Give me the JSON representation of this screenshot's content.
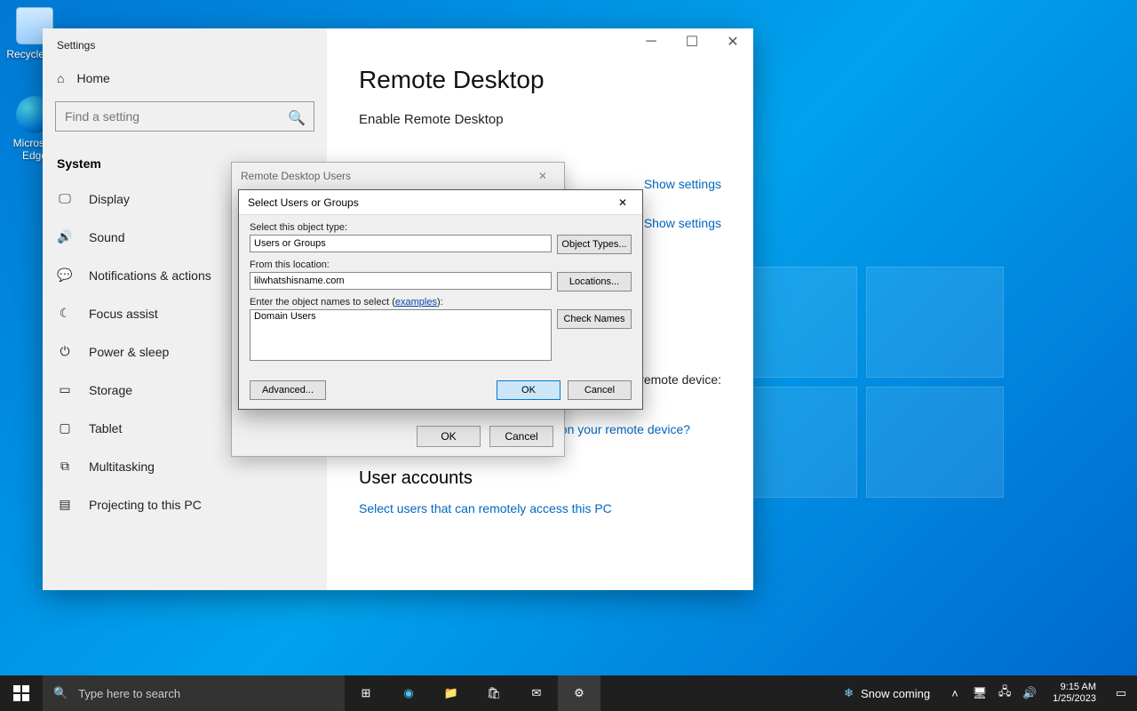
{
  "desktop": {
    "recycle": "Recycle Bin",
    "edge": "Microsoft Edge"
  },
  "settings": {
    "app_title": "Settings",
    "home": "Home",
    "search_placeholder": "Find a setting",
    "system": "System",
    "nav": [
      "Display",
      "Sound",
      "Notifications & actions",
      "Focus assist",
      "Power & sleep",
      "Storage",
      "Tablet",
      "Multitasking",
      "Projecting to this PC"
    ],
    "page_title": "Remote Desktop",
    "enable_label": "Enable Remote Desktop",
    "toggle_state": "On",
    "show_settings": "Show settings",
    "connect_text": "remote device:",
    "client_link": "Don't have a Remote Desktop client on your remote device?",
    "user_accounts": "User accounts",
    "select_users": "Select users that can remotely access this PC"
  },
  "rdu": {
    "title": "Remote Desktop Users",
    "ok": "OK",
    "cancel": "Cancel"
  },
  "sug": {
    "title": "Select Users or Groups",
    "object_type_label": "Select this object type:",
    "object_type_value": "Users or Groups",
    "object_types_btn": "Object Types...",
    "location_label": "From this location:",
    "location_value": "lilwhatshisname.com",
    "locations_btn": "Locations...",
    "names_label_pre": "Enter the object names to select (",
    "names_label_link": "examples",
    "names_label_post": "):",
    "names_value": "Domain Users",
    "check_names": "Check Names",
    "advanced": "Advanced...",
    "ok": "OK",
    "cancel": "Cancel"
  },
  "taskbar": {
    "search_placeholder": "Type here to search",
    "weather": "Snow coming",
    "time": "9:15 AM",
    "date": "1/25/2023"
  }
}
